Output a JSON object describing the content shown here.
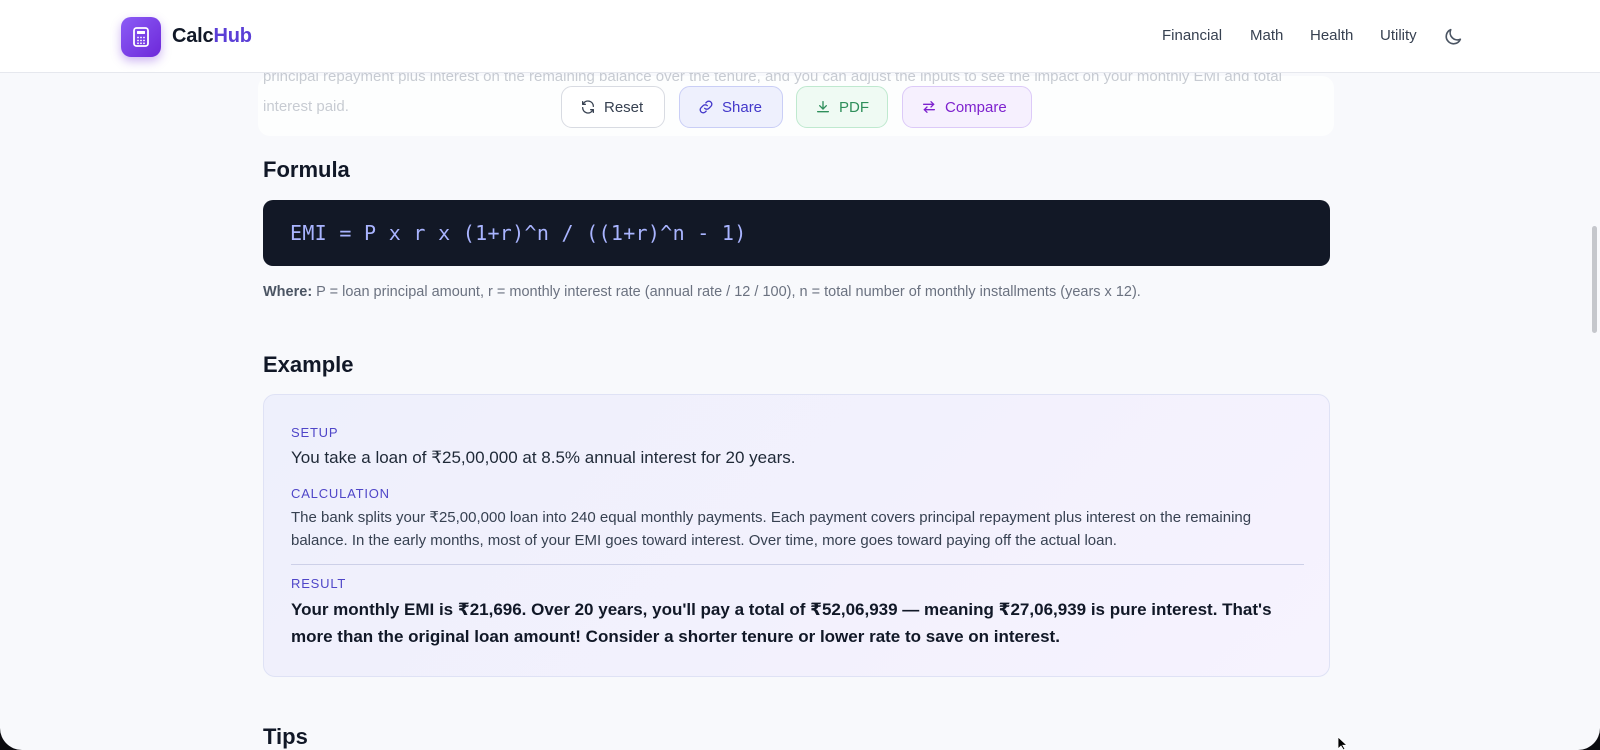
{
  "header": {
    "brand_prefix": "Calc",
    "brand_suffix": "Hub",
    "nav": [
      "Financial",
      "Math",
      "Health",
      "Utility"
    ]
  },
  "faded_text": "principal repayment plus interest on the remaining balance over the tenure, and you can adjust the inputs to see the impact on your monthly EMI and total interest paid.",
  "actions": {
    "reset": "Reset",
    "share": "Share",
    "pdf": "PDF",
    "compare": "Compare"
  },
  "formula": {
    "heading": "Formula",
    "expression": "EMI = P x r x (1+r)^n / ((1+r)^n - 1)",
    "where_label": "Where:",
    "where_text": " P = loan principal amount, r = monthly interest rate (annual rate / 12 / 100), n = total number of monthly installments (years x 12)."
  },
  "example": {
    "heading": "Example",
    "setup_label": "SETUP",
    "setup_text": "You take a loan of ₹25,00,000 at 8.5% annual interest for 20 years.",
    "calc_label": "CALCULATION",
    "calc_text": "The bank splits your ₹25,00,000 loan into 240 equal monthly payments. Each payment covers principal repayment plus interest on the remaining balance. In the early months, most of your EMI goes toward interest. Over time, more goes toward paying off the actual loan.",
    "result_label": "RESULT",
    "result_text": "Your monthly EMI is ₹21,696. Over 20 years, you'll pay a total of ₹52,06,939 — meaning ₹27,06,939 is pure interest. That's more than the original loan amount! Consider a shorter tenure or lower rate to save on interest."
  },
  "tips": {
    "heading": "Tips"
  },
  "colors": {
    "brand": "#6d28d9",
    "formula_bg": "#121826",
    "formula_text": "#a9b4ff",
    "label": "#4f46c8"
  }
}
